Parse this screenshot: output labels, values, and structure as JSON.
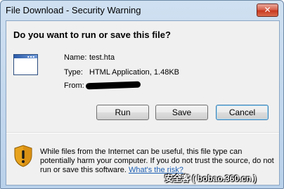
{
  "window": {
    "title": "File Download - Security Warning",
    "close_glyph": "✕"
  },
  "dialog": {
    "question": "Do you want to run or save this file?",
    "file": {
      "icon": "application-window-icon",
      "name_label": "Name:",
      "name_value": "test.hta",
      "type_label": "Type:",
      "type_value": "HTML Application, 1.48KB",
      "from_label": "From:"
    },
    "buttons": {
      "run": "Run",
      "save": "Save",
      "cancel": "Cancel"
    },
    "warning": {
      "icon": "security-shield-warning-icon",
      "text": "While files from the Internet can be useful, this file type can potentially harm your computer. If you do not trust the source, do not run or save this software. ",
      "link": "What's the risk?"
    }
  },
  "watermark": "安全客 ( bobao.360.cn )",
  "colors": {
    "link": "#1c5fb4",
    "close_button": "#c8381f",
    "title_bar": "#b9d1ea"
  }
}
